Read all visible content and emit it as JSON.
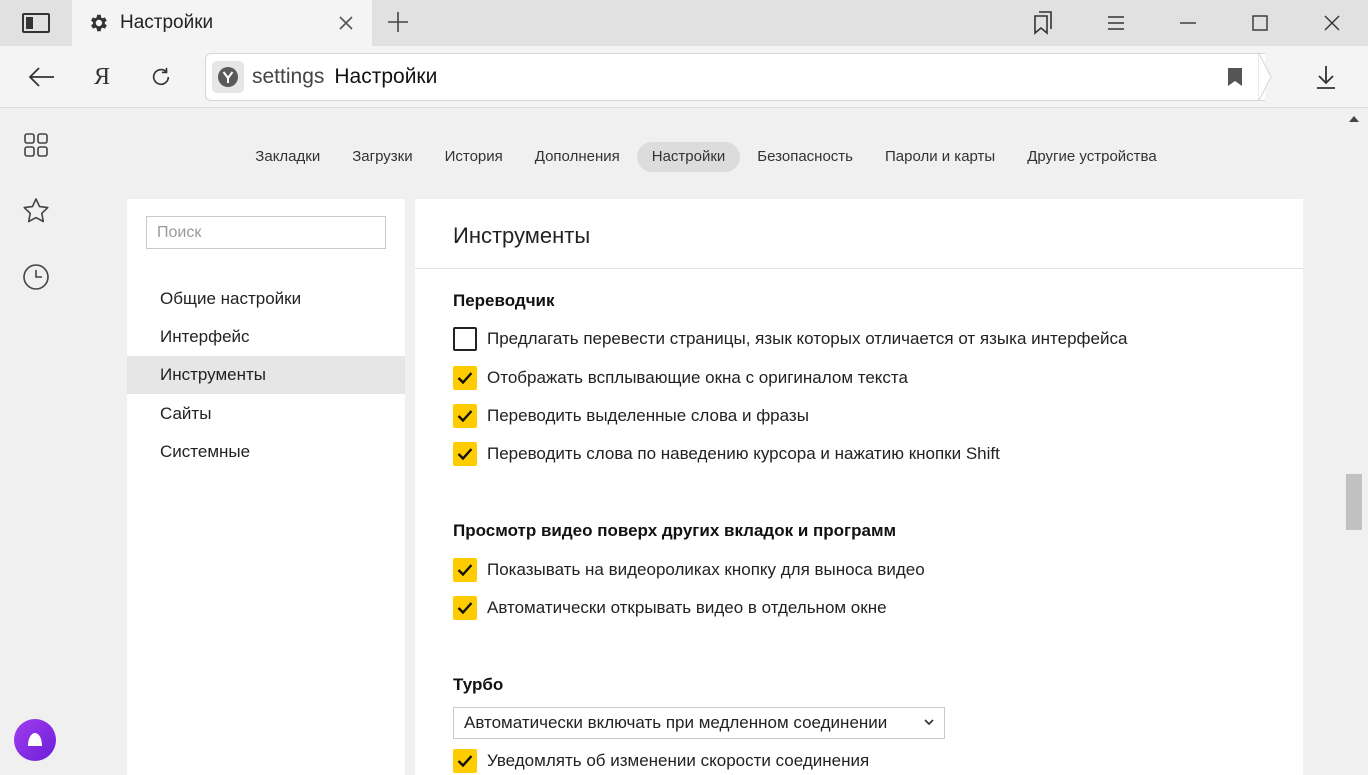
{
  "tab": {
    "title": "Настройки",
    "icon": "gear-icon",
    "close_icon": "close-icon"
  },
  "address_bar": {
    "host": "settings",
    "title": "Настройки"
  },
  "nav_tabs": [
    {
      "label": "Закладки"
    },
    {
      "label": "Загрузки"
    },
    {
      "label": "История"
    },
    {
      "label": "Дополнения"
    },
    {
      "label": "Настройки",
      "active": true
    },
    {
      "label": "Безопасность"
    },
    {
      "label": "Пароли и карты"
    },
    {
      "label": "Другие устройства"
    }
  ],
  "sidebar": {
    "search": {
      "placeholder": "Поиск",
      "value": ""
    },
    "items": [
      {
        "label": "Общие настройки"
      },
      {
        "label": "Интерфейс"
      },
      {
        "label": "Инструменты",
        "active": true
      },
      {
        "label": "Сайты"
      },
      {
        "label": "Системные"
      }
    ]
  },
  "main": {
    "title": "Инструменты",
    "sections": {
      "translator": {
        "title": "Переводчик",
        "options": [
          {
            "label": "Предлагать перевести страницы, язык которых отличается от языка интерфейса",
            "checked": false
          },
          {
            "label": "Отображать всплывающие окна с оригиналом текста",
            "checked": true
          },
          {
            "label": "Переводить выделенные слова и фразы",
            "checked": true
          },
          {
            "label": "Переводить слова по наведению курсора и нажатию кнопки Shift",
            "checked": true
          }
        ]
      },
      "video": {
        "title": "Просмотр видео поверх других вкладок и программ",
        "options": [
          {
            "label": "Показывать на видеороликах кнопку для выноса видео",
            "checked": true
          },
          {
            "label": "Автоматически открывать видео в отдельном окне",
            "checked": true
          }
        ]
      },
      "turbo": {
        "title": "Турбо",
        "select_value": "Автоматически включать при медленном соединении",
        "options": [
          {
            "label": "Уведомлять об изменении скорости соединения",
            "checked": true
          }
        ]
      }
    }
  },
  "colors": {
    "accent": "#ffcc00",
    "alice": "#8a2be2"
  }
}
